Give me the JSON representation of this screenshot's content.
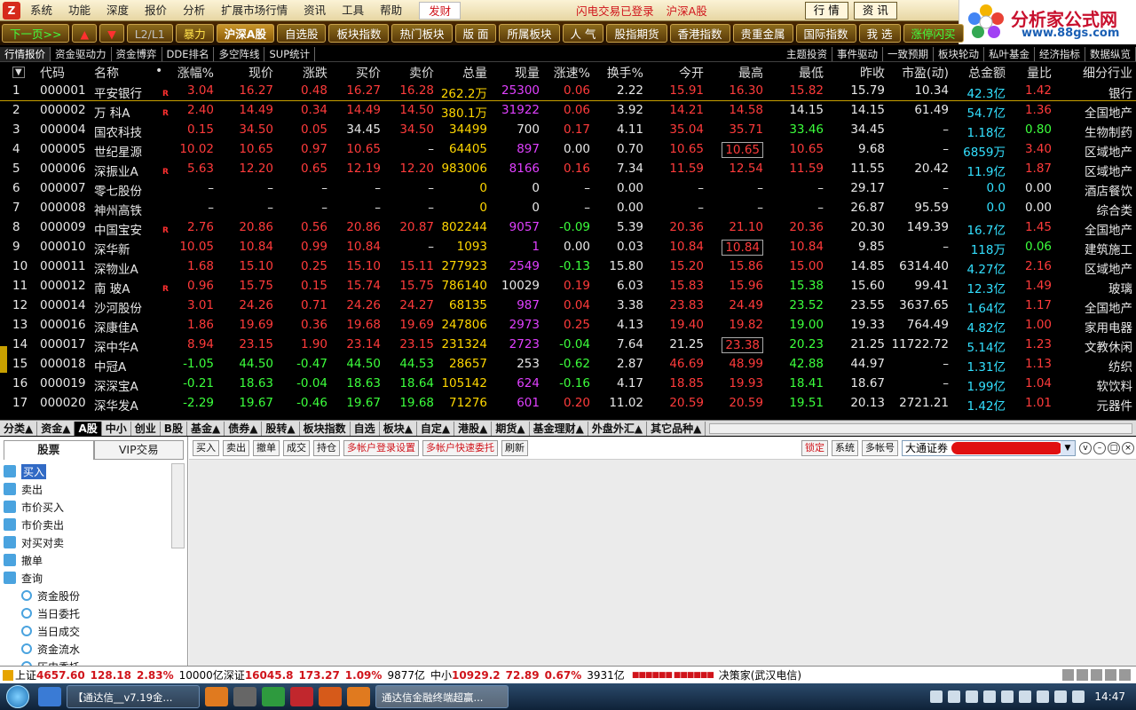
{
  "menu": {
    "items": [
      "系统",
      "功能",
      "深度",
      "报价",
      "分析",
      "扩展市场行情",
      "资讯",
      "工具",
      "帮助"
    ],
    "fa_button": "发财",
    "status": "闪电交易已登录",
    "market": "沪深A股",
    "right_buttons": [
      "行 情",
      "资 讯"
    ]
  },
  "brand": {
    "title": "分析家公式网",
    "url": "www.88gs.com"
  },
  "toolbar": {
    "buttons": [
      {
        "label": "下一页>>",
        "cls": "green"
      },
      {
        "label": "▲",
        "cls": "red"
      },
      {
        "label": "▼",
        "cls": "red"
      },
      {
        "label": "L2/L1",
        "cls": "dim"
      },
      {
        "label": "暴力",
        "cls": "yellow"
      },
      {
        "label": "沪深A股",
        "cls": "active"
      },
      {
        "label": "自选股",
        "cls": ""
      },
      {
        "label": "板块指数",
        "cls": ""
      },
      {
        "label": "热门板块",
        "cls": ""
      },
      {
        "label": "版 面",
        "cls": ""
      },
      {
        "label": "所属板块",
        "cls": ""
      },
      {
        "label": "人 气",
        "cls": ""
      },
      {
        "label": "股指期货",
        "cls": ""
      },
      {
        "label": "香港指数",
        "cls": ""
      },
      {
        "label": "贵重金属",
        "cls": ""
      },
      {
        "label": "国际指数",
        "cls": ""
      },
      {
        "label": "我 选",
        "cls": ""
      },
      {
        "label": "涨停闪买",
        "cls": "green"
      }
    ]
  },
  "subnav": {
    "left": [
      "行情报价",
      "资金驱动力",
      "资金博弈",
      "DDE排名",
      "多空阵线",
      "SUP统计"
    ],
    "right": [
      "主题投资",
      "事件驱动",
      "一致预期",
      "板块轮动",
      "私叶基金",
      "经济指标",
      "数据纵览"
    ]
  },
  "columns": [
    "代码",
    "名称",
    "•",
    "涨幅%",
    "现价",
    "涨跌",
    "买价",
    "卖价",
    "总量",
    "现量",
    "涨速%",
    "换手%",
    "今开",
    "最高",
    "最低",
    "昨收",
    "市盈(动)",
    "总金额",
    "量比",
    "细分行业"
  ],
  "rows": [
    {
      "n": "1",
      "code": "000001",
      "name": "平安银行",
      "r": "R",
      "chg": "3.04",
      "price": "16.27",
      "delta": "0.48",
      "bid": "16.27",
      "ask": "16.28",
      "vol": "262.2万",
      "cur": "25300",
      "spd": "0.06",
      "turn": "2.22",
      "open": "15.91",
      "high": "16.30",
      "low": "15.82",
      "prev": "15.79",
      "pe": "10.34",
      "amt": "42.3亿",
      "vr": "1.42",
      "ind": "银行"
    },
    {
      "n": "2",
      "code": "000002",
      "name": "万 科A",
      "r": "R",
      "chg": "2.40",
      "price": "14.49",
      "delta": "0.34",
      "bid": "14.49",
      "ask": "14.50",
      "vol": "380.1万",
      "cur": "31922",
      "spd": "0.06",
      "turn": "3.92",
      "open": "14.21",
      "high": "14.58",
      "low": "14.15",
      "prev": "14.15",
      "pe": "61.49",
      "amt": "54.7亿",
      "vr": "1.36",
      "ind": "全国地产"
    },
    {
      "n": "3",
      "code": "000004",
      "name": "国农科技",
      "r": "",
      "chg": "0.15",
      "price": "34.50",
      "delta": "0.05",
      "bid": "34.45",
      "ask": "34.50",
      "vol": "34499",
      "cur": "700",
      "spd": "0.17",
      "turn": "4.11",
      "open": "35.04",
      "high": "35.71",
      "low": "33.46",
      "prev": "34.45",
      "pe": "–",
      "amt": "1.18亿",
      "vr": "0.80",
      "ind": "生物制药"
    },
    {
      "n": "4",
      "code": "000005",
      "name": "世纪星源",
      "r": "",
      "chg": "10.02",
      "price": "10.65",
      "delta": "0.97",
      "bid": "10.65",
      "ask": "–",
      "vol": "64405",
      "cur": "897",
      "spd": "0.00",
      "turn": "0.70",
      "open": "10.65",
      "high": "10.65",
      "low": "10.65",
      "prev": "9.68",
      "pe": "–",
      "amt": "6859万",
      "vr": "3.40",
      "ind": "区域地产"
    },
    {
      "n": "5",
      "code": "000006",
      "name": "深振业A",
      "r": "R",
      "chg": "5.63",
      "price": "12.20",
      "delta": "0.65",
      "bid": "12.19",
      "ask": "12.20",
      "vol": "983006",
      "cur": "8166",
      "spd": "0.16",
      "turn": "7.34",
      "open": "11.59",
      "high": "12.54",
      "low": "11.59",
      "prev": "11.55",
      "pe": "20.42",
      "amt": "11.9亿",
      "vr": "1.87",
      "ind": "区域地产"
    },
    {
      "n": "6",
      "code": "000007",
      "name": "零七股份",
      "r": "",
      "chg": "–",
      "price": "–",
      "delta": "–",
      "bid": "–",
      "ask": "–",
      "vol": "0",
      "cur": "0",
      "spd": "–",
      "turn": "0.00",
      "open": "–",
      "high": "–",
      "low": "–",
      "prev": "29.17",
      "pe": "–",
      "amt": "0.0",
      "vr": "0.00",
      "ind": "酒店餐饮"
    },
    {
      "n": "7",
      "code": "000008",
      "name": "神州高铁",
      "r": "",
      "chg": "–",
      "price": "–",
      "delta": "–",
      "bid": "–",
      "ask": "–",
      "vol": "0",
      "cur": "0",
      "spd": "–",
      "turn": "0.00",
      "open": "–",
      "high": "–",
      "low": "–",
      "prev": "26.87",
      "pe": "95.59",
      "amt": "0.0",
      "vr": "0.00",
      "ind": "综合类"
    },
    {
      "n": "8",
      "code": "000009",
      "name": "中国宝安",
      "r": "R",
      "chg": "2.76",
      "price": "20.86",
      "delta": "0.56",
      "bid": "20.86",
      "ask": "20.87",
      "vol": "802244",
      "cur": "9057",
      "spd": "-0.09",
      "turn": "5.39",
      "open": "20.36",
      "high": "21.10",
      "low": "20.36",
      "prev": "20.30",
      "pe": "149.39",
      "amt": "16.7亿",
      "vr": "1.45",
      "ind": "全国地产"
    },
    {
      "n": "9",
      "code": "000010",
      "name": "深华新",
      "r": "",
      "chg": "10.05",
      "price": "10.84",
      "delta": "0.99",
      "bid": "10.84",
      "ask": "–",
      "vol": "1093",
      "cur": "1",
      "spd": "0.00",
      "turn": "0.03",
      "open": "10.84",
      "high": "10.84",
      "low": "10.84",
      "prev": "9.85",
      "pe": "–",
      "amt": "118万",
      "vr": "0.06",
      "ind": "建筑施工"
    },
    {
      "n": "10",
      "code": "000011",
      "name": "深物业A",
      "r": "",
      "chg": "1.68",
      "price": "15.10",
      "delta": "0.25",
      "bid": "15.10",
      "ask": "15.11",
      "vol": "277923",
      "cur": "2549",
      "spd": "-0.13",
      "turn": "15.80",
      "open": "15.20",
      "high": "15.86",
      "low": "15.00",
      "prev": "14.85",
      "pe": "6314.40",
      "amt": "4.27亿",
      "vr": "2.16",
      "ind": "区域地产"
    },
    {
      "n": "11",
      "code": "000012",
      "name": "南 玻A",
      "r": "R",
      "chg": "0.96",
      "price": "15.75",
      "delta": "0.15",
      "bid": "15.74",
      "ask": "15.75",
      "vol": "786140",
      "cur": "10029",
      "spd": "0.19",
      "turn": "6.03",
      "open": "15.83",
      "high": "15.96",
      "low": "15.38",
      "prev": "15.60",
      "pe": "99.41",
      "amt": "12.3亿",
      "vr": "1.49",
      "ind": "玻璃"
    },
    {
      "n": "12",
      "code": "000014",
      "name": "沙河股份",
      "r": "",
      "chg": "3.01",
      "price": "24.26",
      "delta": "0.71",
      "bid": "24.26",
      "ask": "24.27",
      "vol": "68135",
      "cur": "987",
      "spd": "0.04",
      "turn": "3.38",
      "open": "23.83",
      "high": "24.49",
      "low": "23.52",
      "prev": "23.55",
      "pe": "3637.65",
      "amt": "1.64亿",
      "vr": "1.17",
      "ind": "全国地产"
    },
    {
      "n": "13",
      "code": "000016",
      "name": "深康佳A",
      "r": "",
      "chg": "1.86",
      "price": "19.69",
      "delta": "0.36",
      "bid": "19.68",
      "ask": "19.69",
      "vol": "247806",
      "cur": "2973",
      "spd": "0.25",
      "turn": "4.13",
      "open": "19.40",
      "high": "19.82",
      "low": "19.00",
      "prev": "19.33",
      "pe": "764.49",
      "amt": "4.82亿",
      "vr": "1.00",
      "ind": "家用电器"
    },
    {
      "n": "14",
      "code": "000017",
      "name": "深中华A",
      "r": "",
      "chg": "8.94",
      "price": "23.15",
      "delta": "1.90",
      "bid": "23.14",
      "ask": "23.15",
      "vol": "231324",
      "cur": "2723",
      "spd": "-0.04",
      "turn": "7.64",
      "open": "21.25",
      "high": "23.38",
      "low": "20.23",
      "prev": "21.25",
      "pe": "11722.72",
      "amt": "5.14亿",
      "vr": "1.23",
      "ind": "文教休闲"
    },
    {
      "n": "15",
      "code": "000018",
      "name": "中冠A",
      "r": "",
      "chg": "-1.05",
      "price": "44.50",
      "delta": "-0.47",
      "bid": "44.50",
      "ask": "44.53",
      "vol": "28657",
      "cur": "253",
      "spd": "-0.62",
      "turn": "2.87",
      "open": "46.69",
      "high": "48.99",
      "low": "42.88",
      "prev": "44.97",
      "pe": "–",
      "amt": "1.31亿",
      "vr": "1.13",
      "ind": "纺织"
    },
    {
      "n": "16",
      "code": "000019",
      "name": "深深宝A",
      "r": "",
      "chg": "-0.21",
      "price": "18.63",
      "delta": "-0.04",
      "bid": "18.63",
      "ask": "18.64",
      "vol": "105142",
      "cur": "624",
      "spd": "-0.16",
      "turn": "4.17",
      "open": "18.85",
      "high": "19.93",
      "low": "18.41",
      "prev": "18.67",
      "pe": "–",
      "amt": "1.99亿",
      "vr": "1.04",
      "ind": "软饮料"
    },
    {
      "n": "17",
      "code": "000020",
      "name": "深华发A",
      "r": "",
      "chg": "-2.29",
      "price": "19.67",
      "delta": "-0.46",
      "bid": "19.67",
      "ask": "19.68",
      "vol": "71276",
      "cur": "601",
      "spd": "0.20",
      "turn": "11.02",
      "open": "20.59",
      "high": "20.59",
      "low": "19.51",
      "prev": "20.13",
      "pe": "2721.21",
      "amt": "1.42亿",
      "vr": "1.01",
      "ind": "元器件"
    }
  ],
  "bottom_tabs": [
    "分类▲",
    "资金▲",
    "A股",
    "中小",
    "创业",
    "B股",
    "基金▲",
    "债券▲",
    "股转▲",
    "板块指数",
    "自选",
    "板块▲",
    "自定▲",
    "港股▲",
    "期货▲",
    "基金理财▲",
    "外盘外汇▲",
    "其它品种▲"
  ],
  "trade": {
    "tabs": [
      "股票",
      "VIP交易"
    ],
    "tree": [
      {
        "label": "买入",
        "sub": false,
        "sel": true
      },
      {
        "label": "卖出",
        "sub": false
      },
      {
        "label": "市价买入",
        "sub": false
      },
      {
        "label": "市价卖出",
        "sub": false
      },
      {
        "label": "对买对卖",
        "sub": false
      },
      {
        "label": "撤单",
        "sub": false
      },
      {
        "label": "查询",
        "sub": false
      },
      {
        "label": "资金股份",
        "sub": true
      },
      {
        "label": "当日委托",
        "sub": true
      },
      {
        "label": "当日成交",
        "sub": true
      },
      {
        "label": "资金流水",
        "sub": true
      },
      {
        "label": "历史委托",
        "sub": true
      }
    ],
    "toolbar": [
      "买入",
      "卖出",
      "撤单",
      "成交",
      "持仓"
    ],
    "red_buttons": [
      "多帐户登录设置",
      "多帐户快速委托"
    ],
    "refresh": "刷新",
    "right": [
      "锁定",
      "系统",
      "多帐号"
    ],
    "broker": "大通证券"
  },
  "statusbar": {
    "sh_label": "上证",
    "sh_val": "4657.60",
    "sh_chg": "128.18",
    "sh_pct": "2.83%",
    "sh_amt": "10000亿",
    "sz_label": "深证",
    "sz_val": "16045.8",
    "sz_chg": "173.27",
    "sz_pct": "1.09%",
    "sz_amt": "9877亿",
    "zx_label": "中小",
    "zx_val": "10929.2",
    "zx_chg": "72.89",
    "zx_pct": "0.67%",
    "zx_amt": "3931亿",
    "ind": "■■■■■■ ■■■■■■",
    "decision": "决策家(武汉电信)"
  },
  "taskbar": {
    "tasks": [
      "【通达信__v7.19金...",
      "通达信金融终端超赢..."
    ],
    "clock": "14:47"
  },
  "colors": {
    "up": "#ff3b3b",
    "down": "#3cff3c",
    "flat": "#e8e8e8",
    "yellow": "#ffd700",
    "cyan": "#33e0ff",
    "magenta": "#e040ff"
  }
}
